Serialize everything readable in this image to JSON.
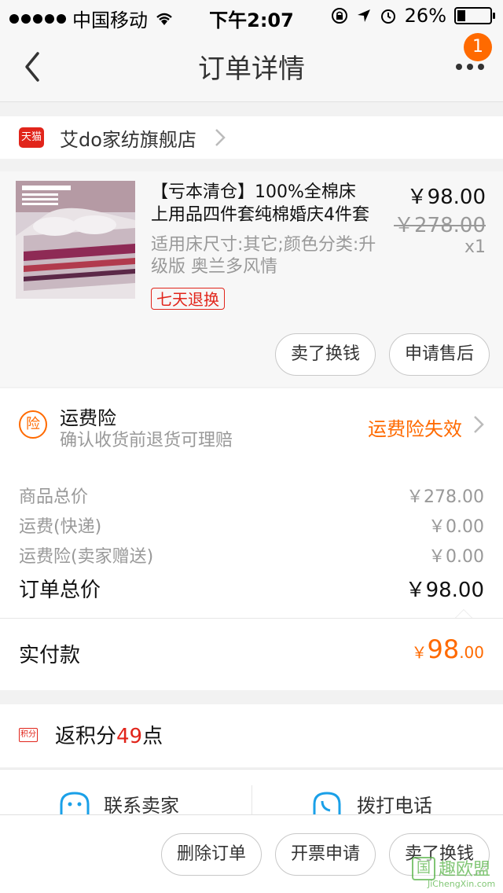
{
  "status_bar": {
    "carrier": "中国移动",
    "time": "下午2:07",
    "battery": "26%",
    "battery_level": 0.26
  },
  "nav": {
    "title": "订单详情",
    "badge": "1"
  },
  "shop": {
    "badge": "天猫",
    "name": "艾do家纺旗舰店"
  },
  "item": {
    "title_line1": "【亏本清仓】100%全棉床",
    "title_line2": "上用品四件套纯棉婚庆4件套",
    "price": "￥98.00",
    "original_price": "￥278.00",
    "quantity": "x1",
    "spec": "适用床尺寸:其它;颜色分类:升级版 奥兰多风情",
    "tag": "七天退换",
    "btn_sell": "卖了换钱",
    "btn_aftersale": "申请售后"
  },
  "insurance": {
    "icon_label": "险",
    "title": "运费险",
    "subtitle": "确认收货前退货可理赔",
    "status": "运费险失效"
  },
  "summary": {
    "rows": [
      {
        "label": "商品总价",
        "value": "￥278.00"
      },
      {
        "label": "运费(快递)",
        "value": "￥0.00"
      },
      {
        "label": "运费险(卖家赠送)",
        "value": "￥0.00"
      }
    ],
    "total_label": "订单总价",
    "total_value": "￥98.00"
  },
  "paid": {
    "label": "实付款",
    "currency": "￥",
    "integer": "98",
    "decimal": ".00"
  },
  "points": {
    "icon_label": "积分",
    "prefix": "返积分",
    "number": "49",
    "suffix": "点"
  },
  "contact": {
    "seller": "联系卖家",
    "call": "拨打电话"
  },
  "actions": {
    "delete": "删除订单",
    "invoice": "开票申请",
    "sell": "卖了换钱"
  },
  "watermark": {
    "logo": "国",
    "main": "趣欧盟",
    "sub": "JiChengXin.com"
  },
  "colors": {
    "accent": "#ff6a00",
    "tmall_red": "#e1251b",
    "muted": "#999999"
  }
}
